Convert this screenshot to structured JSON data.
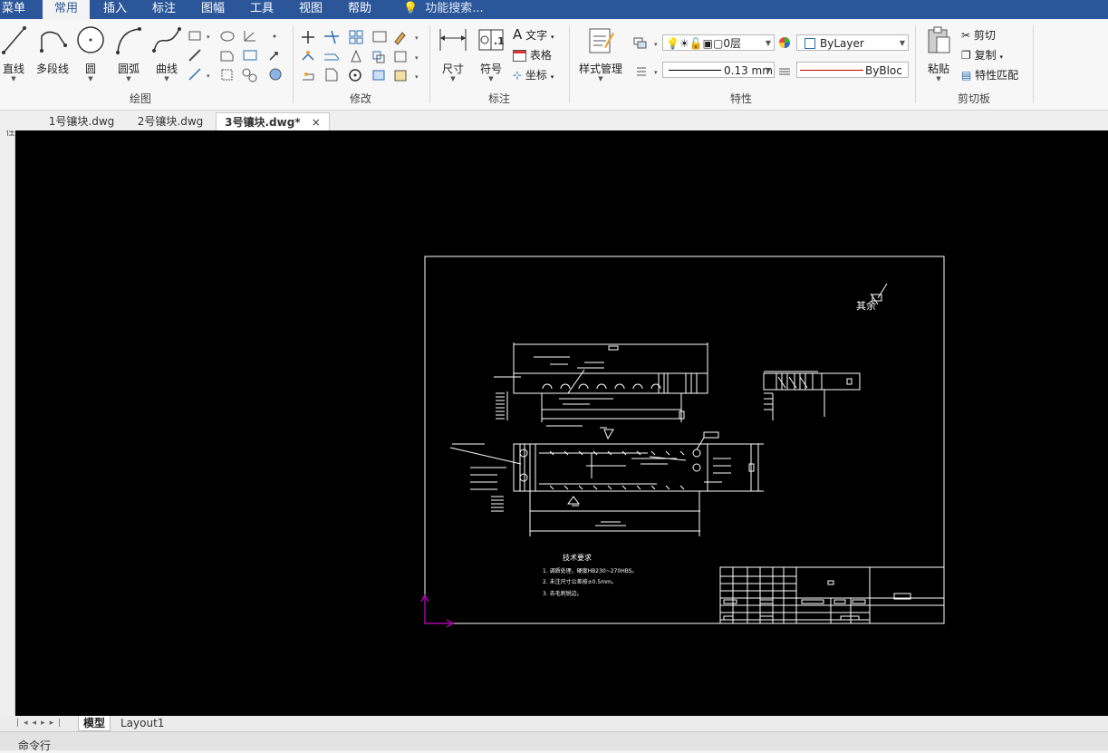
{
  "menubar": {
    "items": [
      "菜单",
      "常用",
      "插入",
      "标注",
      "图幅",
      "工具",
      "视图",
      "帮助"
    ],
    "search_placeholder": "功能搜索..."
  },
  "ribbon": {
    "draw": {
      "label": "绘图",
      "buttons": [
        "直线",
        "多段线",
        "圆",
        "圆弧",
        "曲线"
      ]
    },
    "modify": {
      "label": "修改"
    },
    "annotate": {
      "label": "标注",
      "buttons": [
        "尺寸",
        "符号"
      ],
      "small": [
        "文字",
        "表格",
        "坐标"
      ]
    },
    "properties": {
      "label": "特性",
      "style_button": "样式管理",
      "layer_value": "0层",
      "color_value": "ByLayer",
      "lineweight_value": "0.13 mm",
      "linetype_value": "ByBloc"
    },
    "clipboard": {
      "label": "剪切板",
      "paste": "粘贴",
      "cut": "剪切",
      "copy": "复制",
      "match": "特性匹配"
    }
  },
  "doc_tabs": [
    "1号镶块.dwg",
    "2号镶块.dwg",
    "3号镶块.dwg*"
  ],
  "left_panel_label": "属性",
  "layout_tabs": [
    "模型",
    "Layout1"
  ],
  "command_line": "命令行",
  "drawing": {
    "roughness_note": "其余",
    "tech_title": "技术要求",
    "tech_notes": [
      "1. 调质处理，硬度HB230~270HBS。",
      "2. 未注尺寸公差按±0.5mm。",
      "3. 去毛刺锐边。"
    ]
  },
  "colors": {
    "menubar": "#2b579a",
    "canvas": "#000000",
    "ucs": "#d000d0",
    "linetype_red": "#d00000"
  }
}
